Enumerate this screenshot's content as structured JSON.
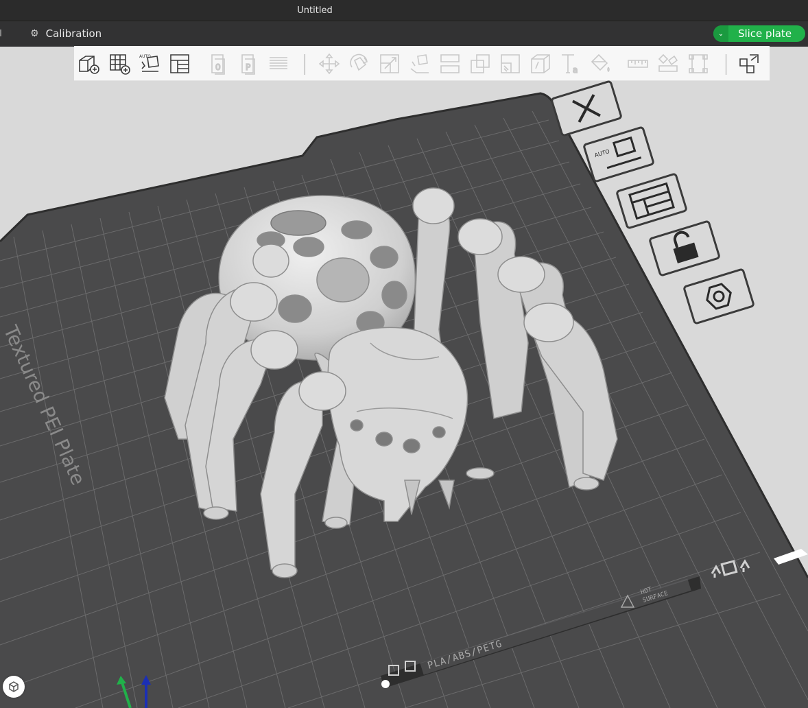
{
  "window": {
    "title": "Untitled"
  },
  "menubar": {
    "calibration_label": "Calibration",
    "slice_button_label": "Slice plate",
    "slice_color": "#21b14a"
  },
  "toolbar": {
    "icons": [
      "add-object-icon",
      "add-plate-icon",
      "auto-orient-icon",
      "arrange-icon",
      "split-objects-icon",
      "split-parts-icon",
      "variable-layer-icon",
      "move-icon",
      "rotate-icon",
      "scale-icon",
      "lay-on-face-icon",
      "cut-icon",
      "mesh-boolean-icon",
      "support-paint-icon",
      "seam-paint-icon",
      "text-icon",
      "color-paint-icon",
      "measure-icon",
      "assembly-icon",
      "assembly-view-icon",
      "fill-bed-icon"
    ]
  },
  "plate": {
    "name": "Textured PEI Plate",
    "material_label": "PLA/ABS/PETG",
    "hot_label": "HOT",
    "surface_label": "SURFACE",
    "plate_color": "#4a4a4b",
    "model_color": "#d4d4d4"
  },
  "plate_tools": [
    "close-plate-icon",
    "auto-orient-plate-icon",
    "arrange-plate-icon",
    "lock-plate-icon",
    "plate-settings-icon"
  ]
}
